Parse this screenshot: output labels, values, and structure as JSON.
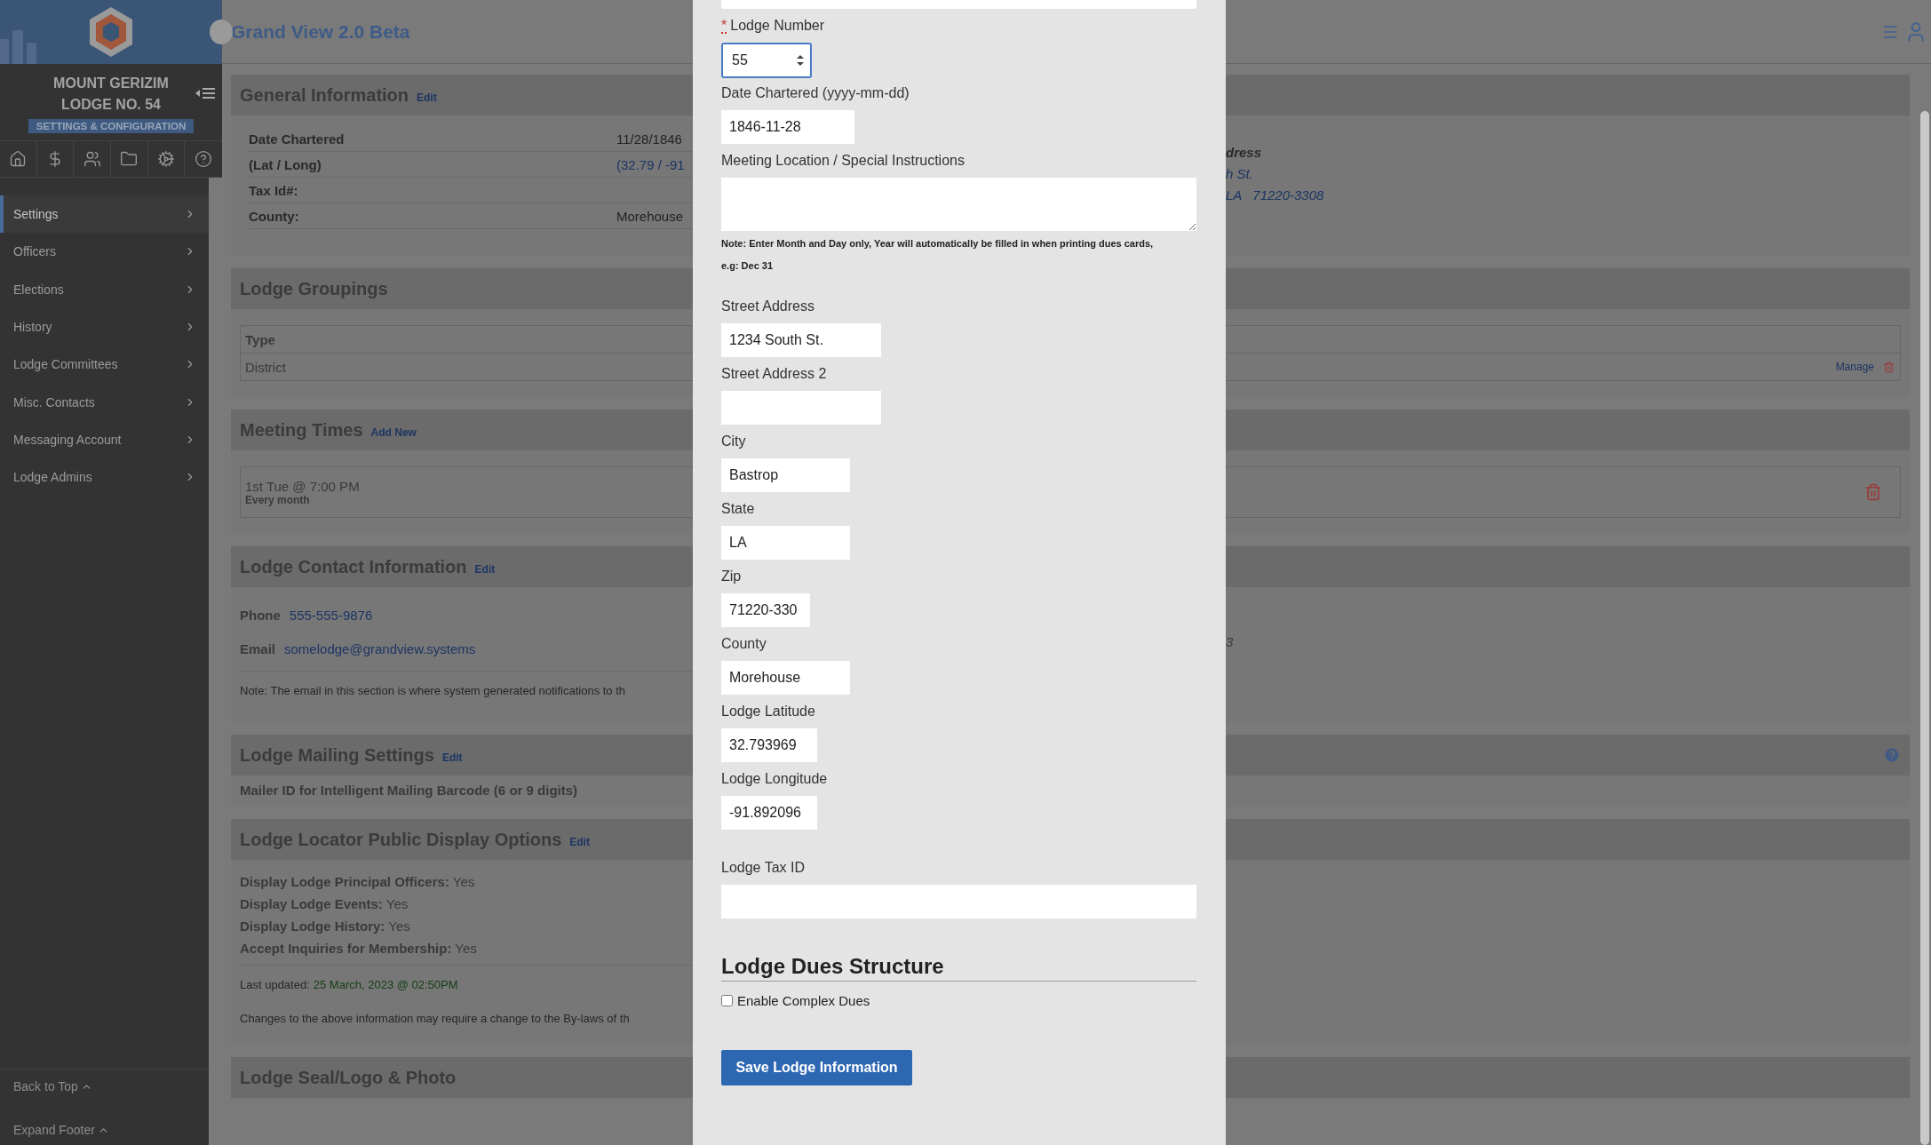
{
  "sidebar": {
    "lodge_name": [
      "MOUNT GERIZIM",
      "LODGE NO. 54"
    ],
    "badge": "SETTINGS & CONFIGURATION",
    "nav_items": [
      {
        "label": "Settings",
        "selected": true
      },
      {
        "label": "Officers",
        "selected": false
      },
      {
        "label": "Elections",
        "selected": false
      },
      {
        "label": "History",
        "selected": false
      },
      {
        "label": "Lodge Committees",
        "selected": false
      },
      {
        "label": "Misc. Contacts",
        "selected": false
      },
      {
        "label": "Messaging Account",
        "selected": false
      },
      {
        "label": "Lodge Admins",
        "selected": false
      }
    ],
    "footer_links": [
      "Back to Top",
      "Expand Footer"
    ]
  },
  "header": {
    "title": "Grand View 2.0 Beta"
  },
  "sections": [
    {
      "kind": "details",
      "title": "General Information",
      "link": "Edit",
      "rows": [
        {
          "label": "Date Chartered",
          "value": "11/28/1846",
          "link": false
        },
        {
          "label": "(Lat / Long)",
          "value": "(32.79 / -91",
          "link": true
        },
        {
          "label": "Tax Id#:"
        },
        {
          "label": "County:",
          "value": "Morehouse",
          "link": false
        }
      ],
      "address": {
        "heading": "dress",
        "lines": [
          "h St.",
          "LA   71220-3308"
        ]
      }
    },
    {
      "kind": "table",
      "title": "Lodge Groupings",
      "column": "Type",
      "cell": "District",
      "action": "Manage"
    },
    {
      "kind": "meeting",
      "title": "Meeting Times",
      "link": "Add New",
      "time": "1st Tue @ 7:00 PM",
      "repeat": "Every month"
    },
    {
      "kind": "contact",
      "title": "Lodge Contact Information",
      "link": "Edit",
      "phone_label": "Phone",
      "phone": "555-555-9876",
      "email_label": "Email",
      "email": "somelodge@grandview.systems",
      "note": "Note: The email in this section is where system generated notifications to th",
      "mailing_fragment": "3"
    },
    {
      "kind": "mailer",
      "title": "Lodge Mailing Settings",
      "link": "Edit",
      "text": "Mailer ID for Intelligent Mailing Barcode (6 or 9 digits)"
    },
    {
      "kind": "locator",
      "title": "Lodge Locator Public Display Options",
      "link": "Edit",
      "options": [
        {
          "label": "Display Lodge Principal Officers:",
          "value": "Yes"
        },
        {
          "label": "Display Lodge Events:",
          "value": "Yes"
        },
        {
          "label": "Display Lodge History:",
          "value": "Yes"
        },
        {
          "label": "Accept Inquiries for Membership:",
          "value": "Yes"
        }
      ],
      "updated_label": "Last updated:",
      "updated": "25 March, 2023 @ 02:50PM",
      "changes": "Changes to the above information may require a change to the By-laws of th"
    },
    {
      "kind": "seal",
      "title": "Lodge Seal/Logo & Photo"
    }
  ],
  "modal": {
    "fields": [
      {
        "kind": "number",
        "label": "Lodge Number",
        "required_mark": "*",
        "value": "55",
        "focused": true
      },
      {
        "kind": "text",
        "label": "Date Chartered (yyyy-mm-dd)",
        "value": "1846-11-28"
      },
      {
        "kind": "textarea",
        "label": "Meeting Location / Special Instructions"
      },
      {
        "kind": "note",
        "lines": [
          "Note: Enter Month and Day only, Year will automatically be filled in when printing dues cards,",
          "e.g: Dec 31"
        ]
      },
      {
        "kind": "text",
        "label": "Street Address",
        "value": "1234 South St."
      },
      {
        "kind": "text",
        "label": "Street Address 2"
      },
      {
        "kind": "text",
        "label": "City",
        "value": "Bastrop"
      },
      {
        "kind": "text",
        "label": "State",
        "value": "LA"
      },
      {
        "kind": "text",
        "label": "Zip",
        "value": "71220-330"
      },
      {
        "kind": "text",
        "label": "County",
        "value": "Morehouse"
      },
      {
        "kind": "text",
        "label": "Lodge Latitude",
        "value": "32.793969"
      },
      {
        "kind": "text",
        "label": "Lodge Longitude",
        "value": "-91.892096"
      }
    ],
    "tax_field": {
      "label": "Lodge Tax ID"
    },
    "dues_heading": "Lodge Dues Structure",
    "checkbox": {
      "label": "Enable Complex Dues",
      "checked": false
    },
    "save_button": "Save Lodge Information"
  }
}
